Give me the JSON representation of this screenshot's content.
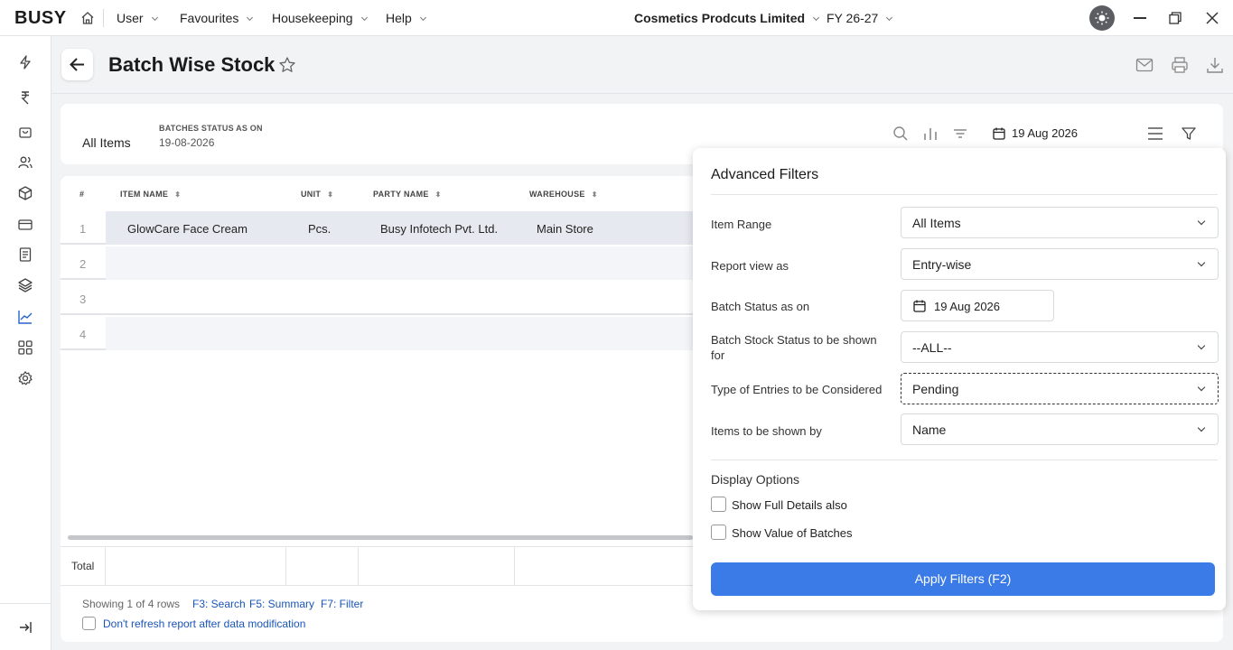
{
  "app": {
    "logo": "BUSY",
    "menu": [
      "User",
      "Favourites",
      "Housekeeping",
      "Help"
    ],
    "company": "Cosmetics Prodcuts Limited",
    "fy": "FY 26-27"
  },
  "page": {
    "title": "Batch Wise Stock"
  },
  "filter_bar": {
    "item_selection": "All Items",
    "batches_status_label": "BATCHES STATUS AS ON",
    "batches_status_value": "19-08-2026",
    "date": "19 Aug 2026"
  },
  "table": {
    "columns": [
      "#",
      "ITEM NAME",
      "UNIT",
      "PARTY NAME",
      "WAREHOUSE"
    ],
    "rows": [
      {
        "num": "1",
        "item": "GlowCare Face Cream",
        "unit": "Pcs.",
        "party": "Busy Infotech Pvt. Ltd.",
        "warehouse": "Main Store"
      },
      {
        "num": "2"
      },
      {
        "num": "3"
      },
      {
        "num": "4"
      }
    ],
    "total_label": "Total"
  },
  "footer": {
    "showing": "Showing 1 of 4 rows",
    "keys": [
      "F3: Search",
      "F5: Summary",
      "F7: Filter"
    ],
    "refresh_checkbox": "Don't refresh report after data modification"
  },
  "advanced_filters": {
    "title": "Advanced Filters",
    "fields": [
      {
        "label": "Item Range",
        "value": "All Items"
      },
      {
        "label": "Report view as",
        "value": "Entry-wise"
      },
      {
        "label": "Batch Status as on",
        "value": "19 Aug 2026"
      },
      {
        "label": "Batch Stock Status to be shown for",
        "value": "--ALL--"
      },
      {
        "label": "Type of Entries to be Considered",
        "value": "Pending"
      },
      {
        "label": "Items to be shown by",
        "value": "Name"
      }
    ],
    "display_options_title": "Display Options",
    "options": [
      "Show Full Details also",
      "Show Value of Batches"
    ],
    "apply_button": "Apply Filters (F2)"
  }
}
